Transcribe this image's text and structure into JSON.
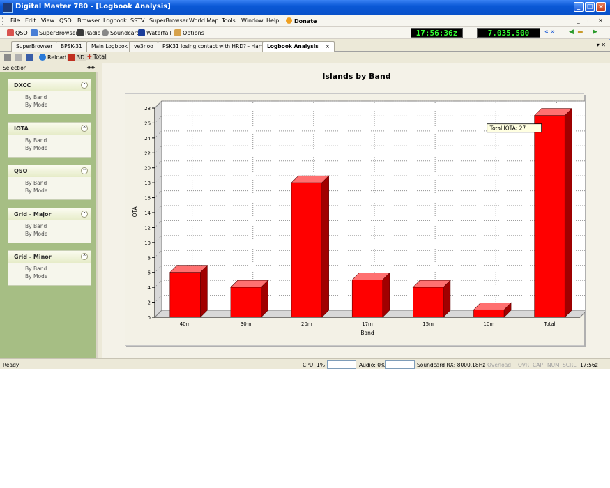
{
  "window": {
    "title": "Digital Master 780 - [Logbook Analysis]",
    "controls": [
      "_",
      "□",
      "×"
    ]
  },
  "menu": {
    "items": [
      "File",
      "Edit",
      "View",
      "QSO",
      "Browser",
      "Logbook",
      "SSTV",
      "SuperBrowser",
      "World Map",
      "Tools",
      "Window",
      "Help"
    ],
    "donate": "Donate",
    "mdi_controls": "_ ▫ ✕"
  },
  "toolbar": {
    "items": [
      "QSO",
      "SuperBrowser",
      "Radio",
      "Soundcard",
      "Waterfall",
      "Options"
    ],
    "clock": "17:56:36z",
    "frequency": "7.035.500",
    "nav": "«  »"
  },
  "tabs": {
    "items": [
      "SuperBrowser",
      "BPSK-31",
      "Main Logbook",
      "ve3noo",
      "PSK31 losing contact with HRD? - Ham…",
      "Logbook Analysis"
    ],
    "active_index": 5,
    "close": "×",
    "right_controls": "▾ ✕"
  },
  "subtoolbar": {
    "reload": "Reload",
    "three_d": "3D",
    "total": "Total"
  },
  "selection": {
    "title": "Selection",
    "pin": "ᚔ",
    "groups": [
      {
        "title": "DXCC",
        "links": [
          "By Band",
          "By Mode"
        ]
      },
      {
        "title": "IOTA",
        "links": [
          "By Band",
          "By Mode"
        ]
      },
      {
        "title": "QSO",
        "links": [
          "By Band",
          "By Mode"
        ]
      },
      {
        "title": "Grid - Major",
        "links": [
          "By Band",
          "By Mode"
        ]
      },
      {
        "title": "Grid - Minor",
        "links": [
          "By Band",
          "By Mode"
        ]
      }
    ]
  },
  "chart_data": {
    "type": "bar",
    "title": "Islands by Band",
    "xlabel": "Band",
    "ylabel": "IOTA",
    "categories": [
      "40m",
      "30m",
      "20m",
      "17m",
      "15m",
      "10m",
      "Total"
    ],
    "values": [
      6,
      4,
      18,
      5,
      4,
      1,
      27
    ],
    "ylim": [
      0,
      28
    ],
    "yticks": [
      0,
      2,
      4,
      6,
      8,
      10,
      12,
      14,
      16,
      18,
      20,
      22,
      24,
      26,
      28
    ],
    "grid": true,
    "style": "3d",
    "bar_color": "#ff0000",
    "tooltip": "Total IOTA: 27"
  },
  "status": {
    "ready": "Ready",
    "cpu": "CPU: 1%",
    "audio": "Audio: 0%",
    "soundcard": "Soundcard RX: 8000.18Hz",
    "overload": "Overload",
    "ovr": "OVR",
    "cap": "CAP",
    "num": "NUM",
    "scrl": "SCRL",
    "time": "17:56z"
  }
}
